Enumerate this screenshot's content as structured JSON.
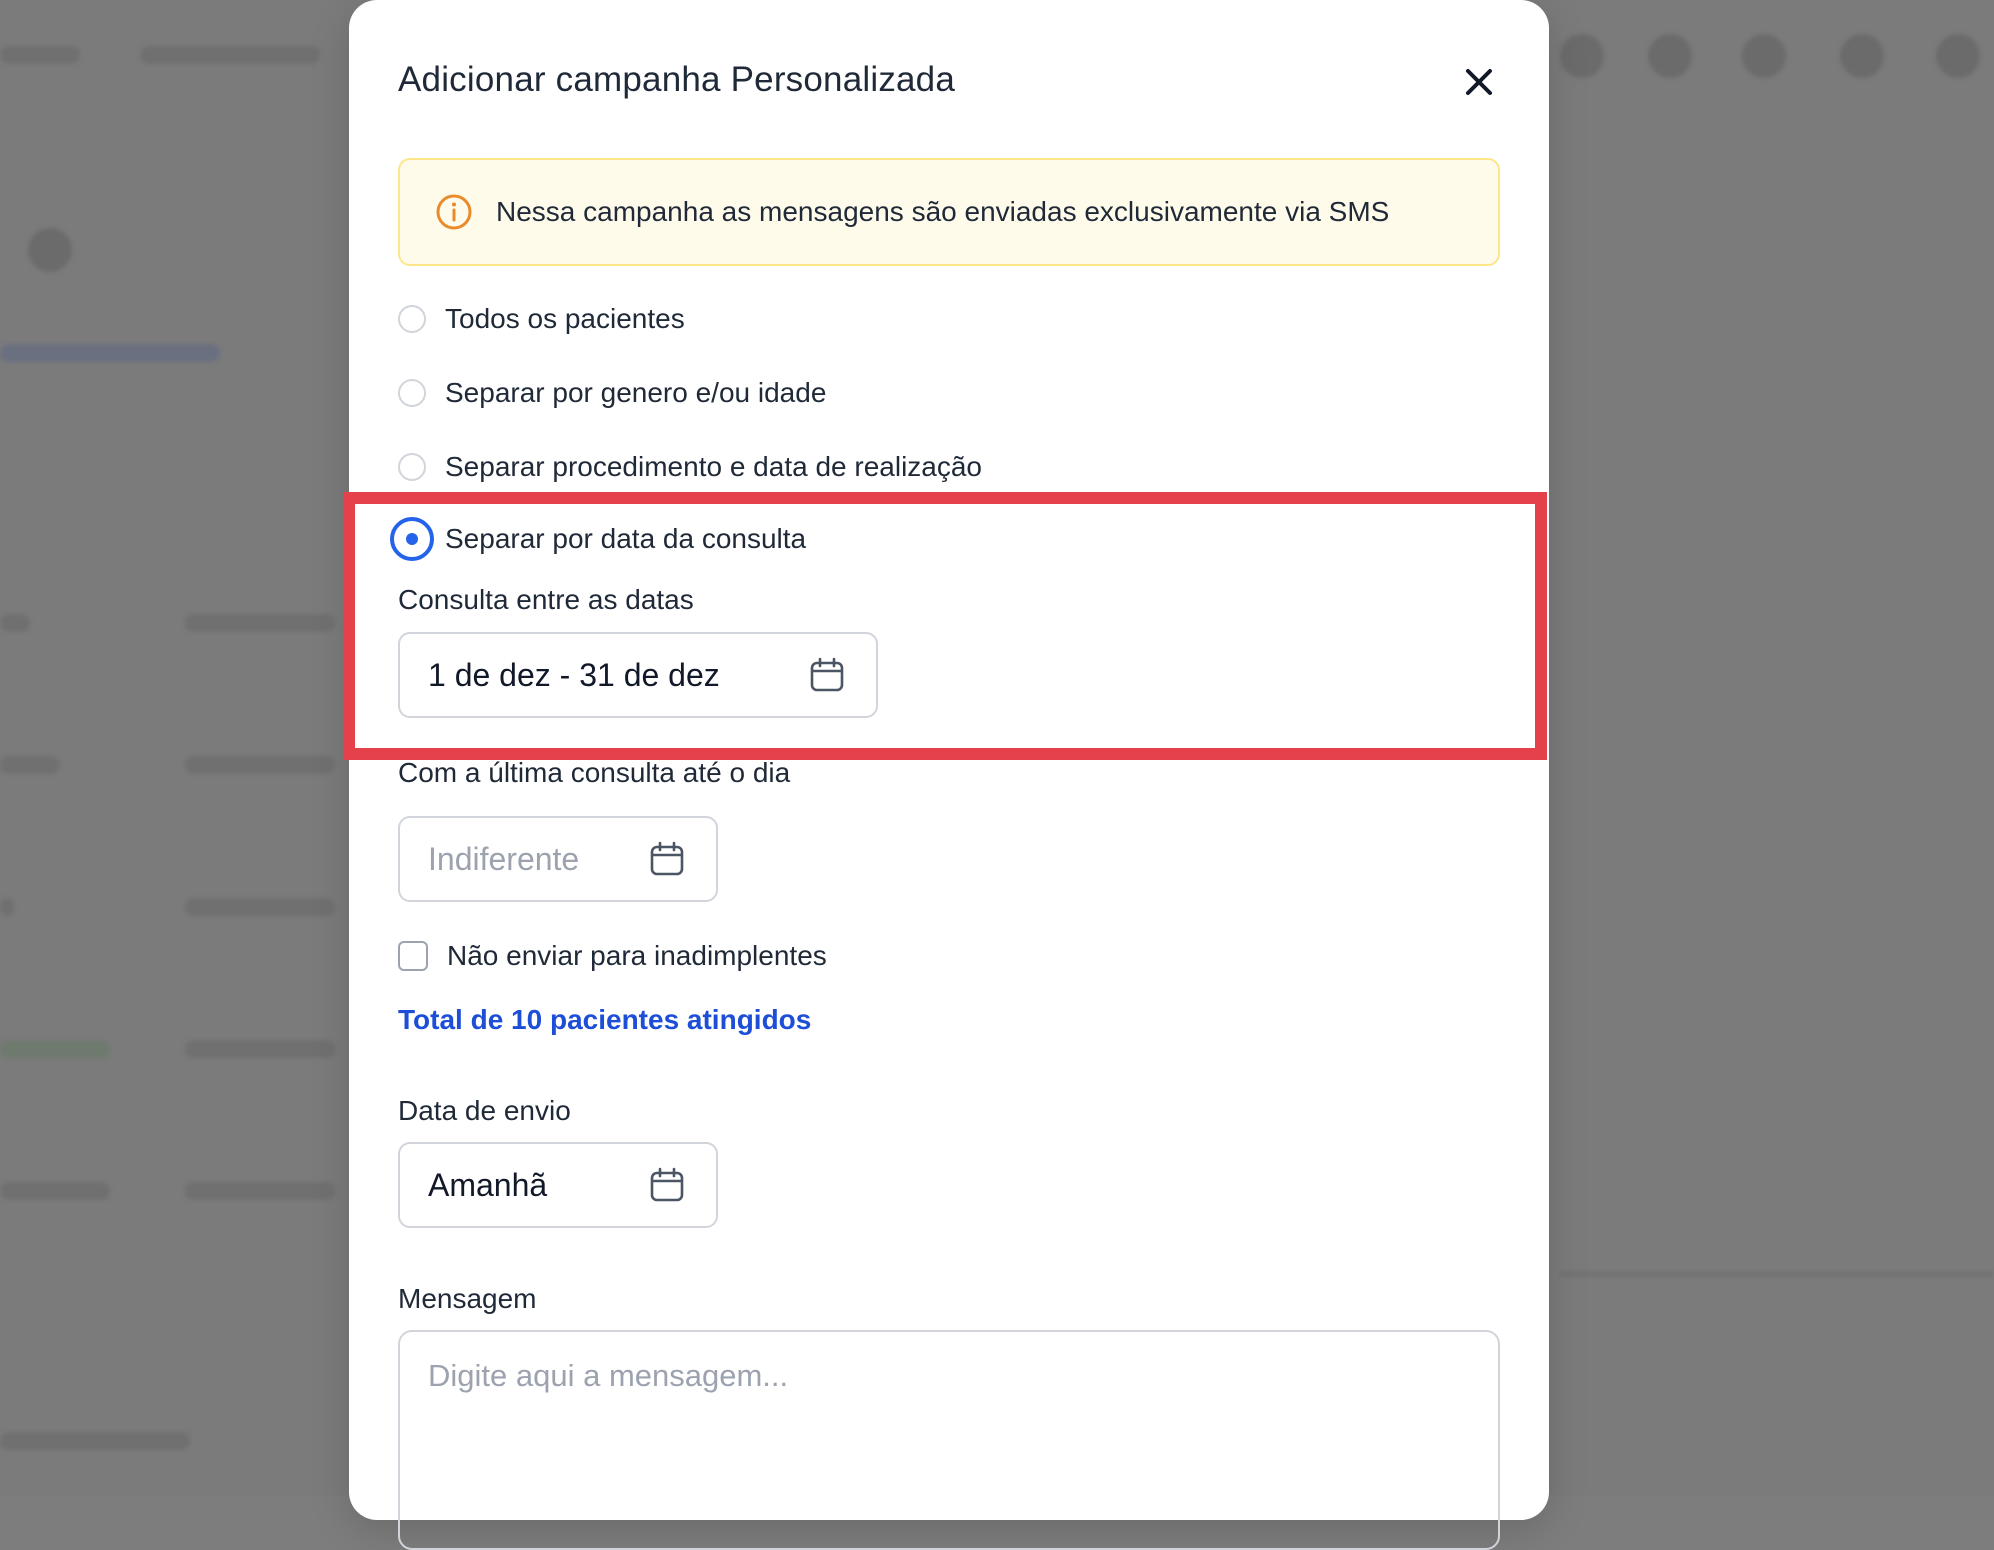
{
  "modal": {
    "title": "Adicionar campanha Personalizada",
    "alert_text": "Nessa campanha as mensagens são enviadas exclusivamente via SMS"
  },
  "audience_options": [
    {
      "label": "Todos os pacientes",
      "selected": false
    },
    {
      "label": "Separar por genero e/ou idade",
      "selected": false
    },
    {
      "label": "Separar procedimento e data de realização",
      "selected": false
    },
    {
      "label": "Separar por data da consulta",
      "selected": true
    }
  ],
  "consult_range": {
    "label": "Consulta entre as datas",
    "value": "1 de dez - 31 de dez"
  },
  "last_consult": {
    "label": "Com a última consulta até o dia",
    "placeholder": "Indiferente"
  },
  "exclude_defaulters": {
    "label": "Não enviar para inadimplentes",
    "checked": false
  },
  "total_reached": "Total de 10 pacientes atingidos",
  "send_date": {
    "label": "Data de envio",
    "value": "Amanhã"
  },
  "message": {
    "label": "Mensagem",
    "placeholder": "Digite aqui a mensagem..."
  },
  "colors": {
    "accent": "#2563eb",
    "highlight": "#e5414a",
    "alert_bg": "#fffbeb",
    "alert_border": "#fde68a",
    "alert_icon": "#ea8a2b"
  }
}
